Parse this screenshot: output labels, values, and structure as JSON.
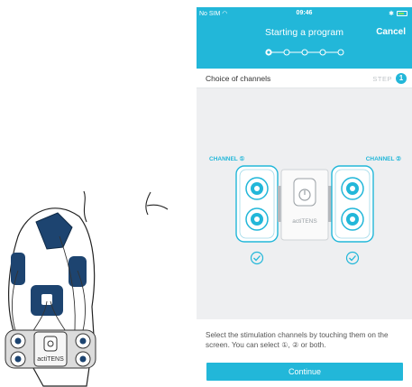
{
  "status_bar": {
    "carrier": "No SIM",
    "time": "09:46",
    "bluetooth": "✱"
  },
  "header": {
    "title": "Starting a program",
    "cancel_label": "Cancel",
    "progress": {
      "total_steps": 5,
      "current_step": 1
    }
  },
  "step_bar": {
    "heading": "Choice of channels",
    "step_label": "STEP",
    "step_number": "1"
  },
  "channels": {
    "left_label": "CHANNEL ①",
    "right_label": "CHANNEL ②",
    "device_brand": "actiTENS",
    "left_selected": true,
    "right_selected": true
  },
  "instructions": {
    "text": "Select the stimulation channels by touching them on the screen. You can select ①, ② or both.",
    "continue_label": "Continue"
  },
  "illustration": {
    "device_brand": "actiTENS"
  },
  "colors": {
    "accent": "#22b7d9",
    "electrode_navy": "#1d4470",
    "canvas_bg": "#eeeff1"
  }
}
